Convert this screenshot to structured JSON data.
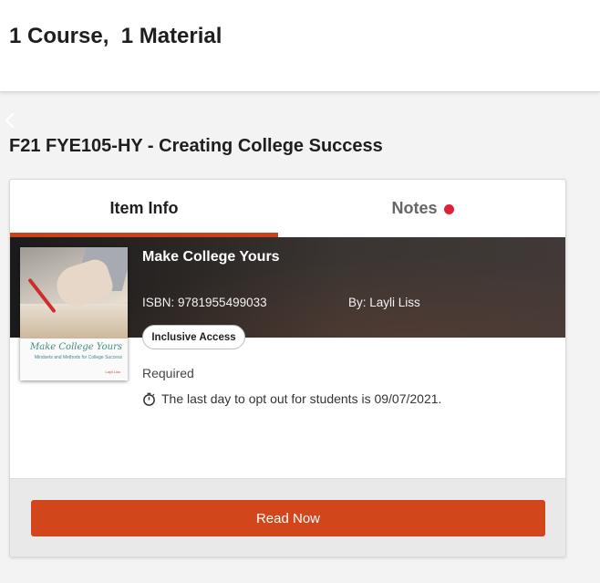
{
  "header": {
    "summary": "1 Course,  1 Material"
  },
  "course": {
    "title": "F21 FYE105-HY - Creating College Success"
  },
  "tabs": [
    {
      "label": "Item Info",
      "active": true
    },
    {
      "label": "Notes",
      "has_notification": true
    }
  ],
  "item": {
    "title": "Make College Yours",
    "isbn": "ISBN: 9781955499033",
    "author": "By: Layli Liss",
    "badge": "Inclusive Access",
    "requirement": "Required",
    "opt_out_notice": "The last day to opt out for students is 09/07/2021.",
    "cover": {
      "title": "Make College Yours",
      "subtitle": "Mindsets and Methods for College Success",
      "author": "Layli Liss"
    }
  },
  "actions": {
    "primary": "Read Now"
  },
  "colors": {
    "accent": "#d2461c",
    "tab_underline": "#c7431c",
    "notification_dot": "#e0213a"
  },
  "icons": [
    "chevron-left-icon",
    "notification-dot-icon",
    "timer-icon"
  ]
}
